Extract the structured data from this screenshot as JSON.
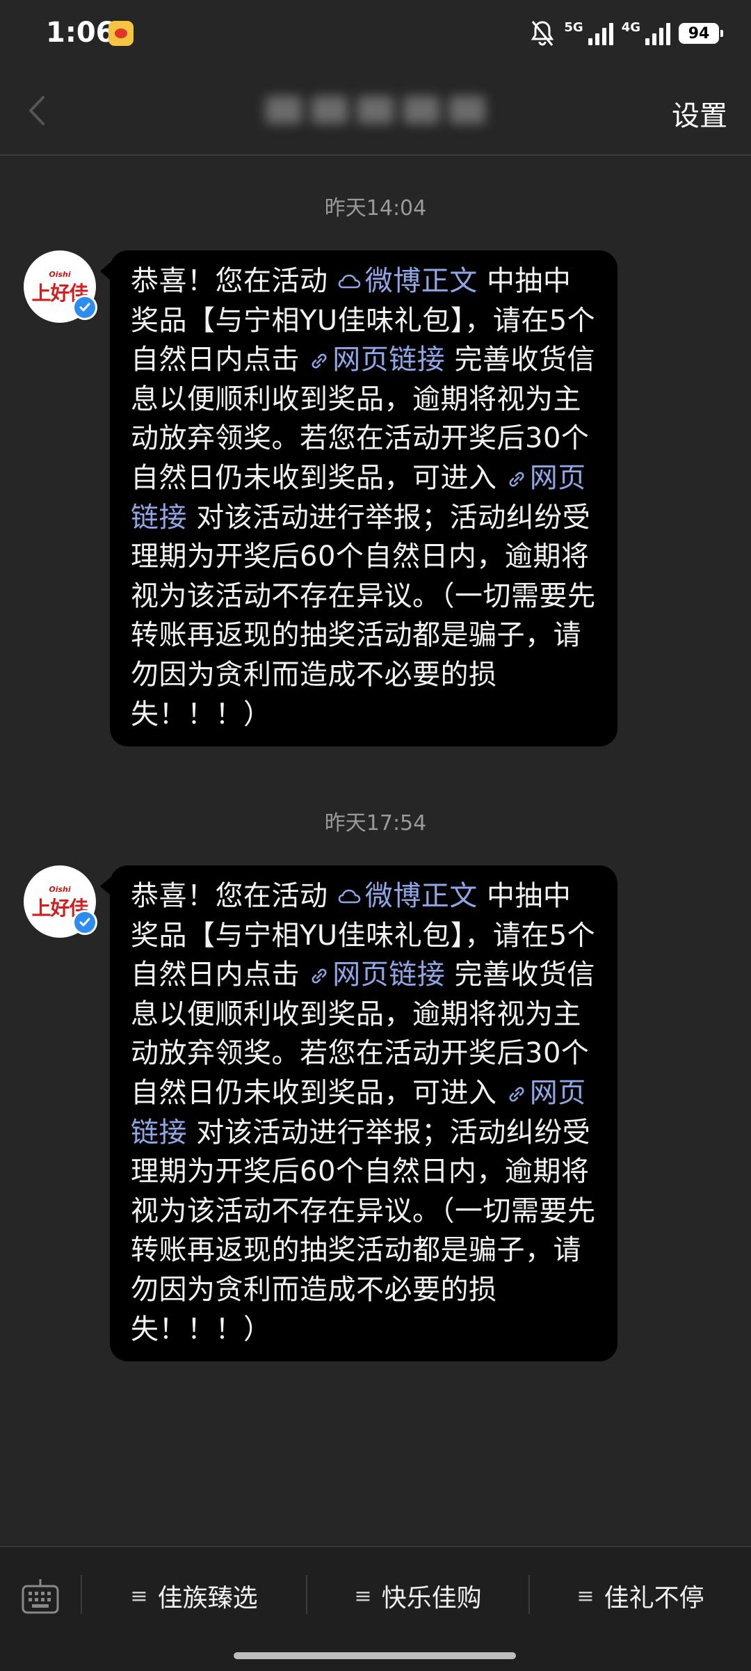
{
  "status_bar": {
    "time": "1:06",
    "network_5g": "5G",
    "network_4g": "4G",
    "battery": "94"
  },
  "header": {
    "settings_label": "设置"
  },
  "messages": [
    {
      "timestamp": "昨天14:04",
      "avatar": {
        "brand_small": "Oishi",
        "brand_text": "上好佳"
      },
      "seg1": "恭喜！您在活动",
      "link1": "微博正文",
      "seg2": "中抽中奖品【与宁相YU佳味礼包】，请在5个自然日内点击",
      "link2": "网页链接",
      "seg3": "完善收货信息以便顺利收到奖品，逾期将视为主动放弃领奖。若您在活动开奖后30个自然日仍未收到奖品，可进入",
      "link3": "网页链接",
      "seg4": "对该活动进行举报；活动纠纷受理期为开奖后60个自然日内，逾期将视为该活动不存在异议。（一切需要先转账再返现的抽奖活动都是骗子，请勿因为贪利而造成不必要的损失！！！）"
    },
    {
      "timestamp": "昨天17:54",
      "avatar": {
        "brand_small": "Oishi",
        "brand_text": "上好佳"
      },
      "seg1": "恭喜！您在活动",
      "link1": "微博正文",
      "seg2": "中抽中奖品【与宁相YU佳味礼包】，请在5个自然日内点击",
      "link2": "网页链接",
      "seg3": "完善收货信息以便顺利收到奖品，逾期将视为主动放弃领奖。若您在活动开奖后30个自然日仍未收到奖品，可进入",
      "link3": "网页链接",
      "seg4": "对该活动进行举报；活动纠纷受理期为开奖后60个自然日内，逾期将视为该活动不存在异议。（一切需要先转账再返现的抽奖活动都是骗子，请勿因为贪利而造成不必要的损失！！！）"
    }
  ],
  "bottom_menu": [
    {
      "label": "佳族臻选",
      "icon": "menu-lines-icon"
    },
    {
      "label": "快乐佳购",
      "icon": "menu-lines-icon"
    },
    {
      "label": "佳礼不停",
      "icon": "menu-lines-icon"
    }
  ],
  "colors": {
    "link": "#8fa7e6",
    "bubble": "#000000",
    "background": "#262626",
    "verified": "#2d8cf0"
  }
}
